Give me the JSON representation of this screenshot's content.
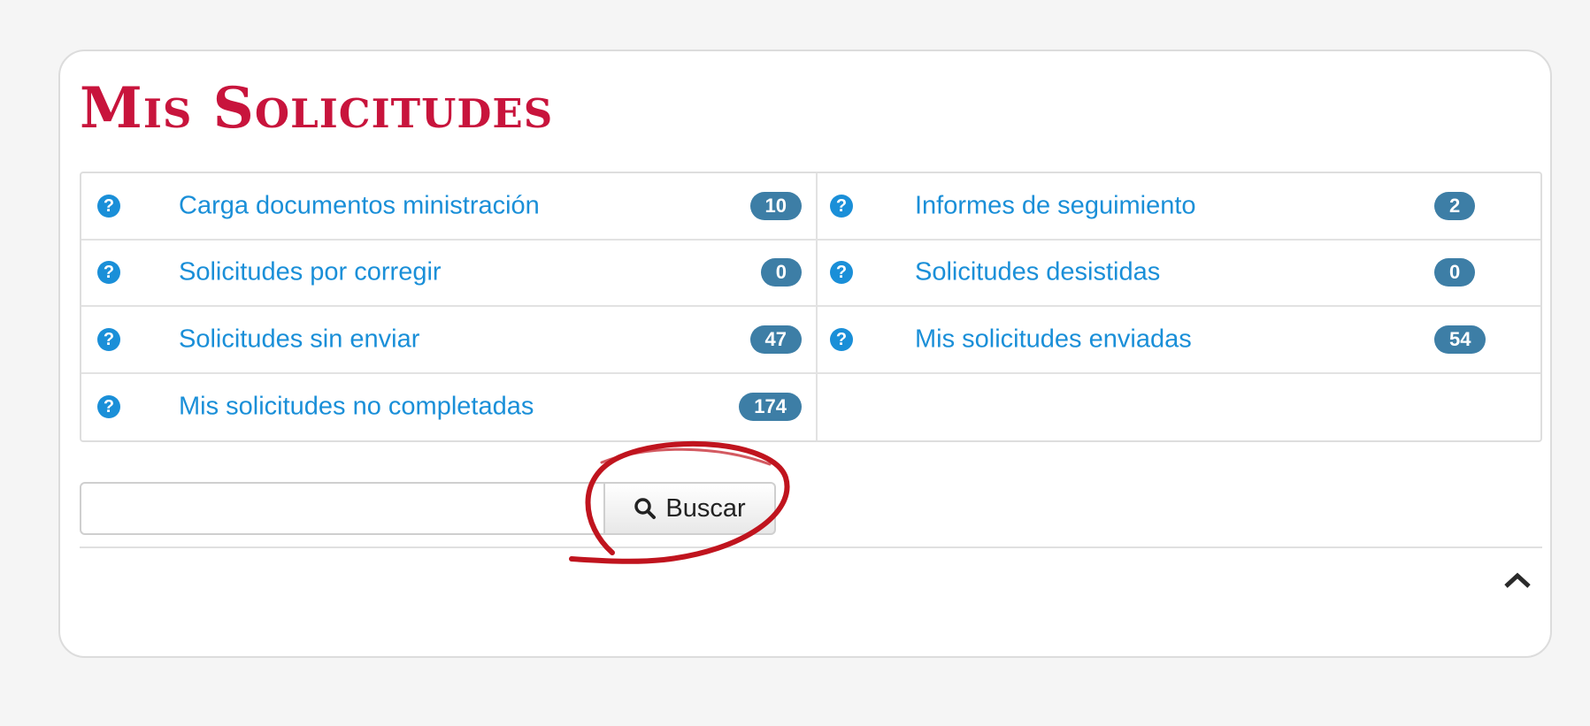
{
  "page": {
    "title": "Mis Solicitudes"
  },
  "items": [
    {
      "label": "Carga documentos ministración",
      "count": "10"
    },
    {
      "label": "Informes de seguimiento",
      "count": "2"
    },
    {
      "label": "Solicitudes por corregir",
      "count": "0"
    },
    {
      "label": "Solicitudes desistidas",
      "count": "0"
    },
    {
      "label": "Solicitudes sin enviar",
      "count": "47"
    },
    {
      "label": "Mis solicitudes enviadas",
      "count": "54"
    },
    {
      "label": "Mis solicitudes no completadas",
      "count": "174"
    }
  ],
  "search": {
    "value": "",
    "placeholder": "",
    "button_label": "Buscar"
  },
  "icons": {
    "help": "question-circle-icon",
    "search": "magnifier-icon",
    "collapse": "chevron-up-icon"
  },
  "colors": {
    "title": "#c8143c",
    "link": "#1a8fd8",
    "badge": "#3d7ea6",
    "annotation": "#c0141e"
  }
}
